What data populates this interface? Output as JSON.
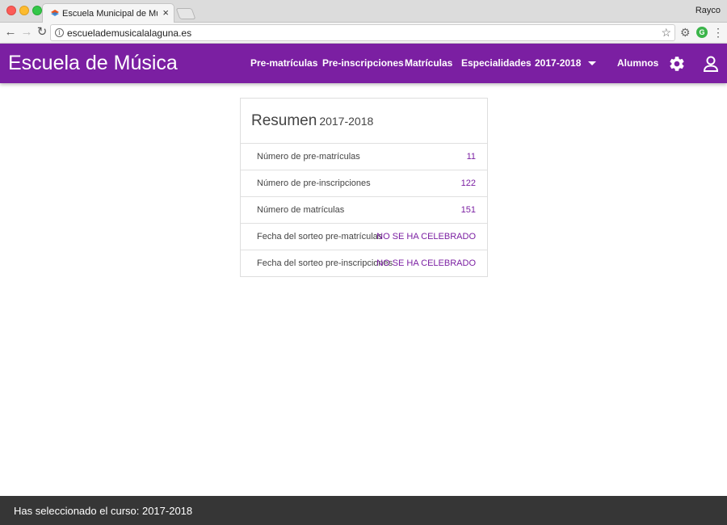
{
  "browser": {
    "tab_title": "Escuela Municipal de Música",
    "tab_close": "×",
    "profile_name": "Rayco",
    "url": "escuelademusicalalaguna.es",
    "icons": [
      "back-icon",
      "forward-icon",
      "reload-icon",
      "info-icon",
      "star-icon",
      "extension-gear-icon",
      "grammarly-icon",
      "menu-dots-icon"
    ]
  },
  "appbar": {
    "title": "Escuela de Música",
    "nav": {
      "premat": "Pre-matrículas",
      "preins": "Pre-inscripciones",
      "mat": "Matrículas",
      "esp": "Especialidades",
      "year": "2017-2018",
      "alumnos": "Alumnos"
    },
    "icons": [
      "settings-icon",
      "account-icon",
      "caret-down-icon"
    ],
    "color": "#7b1fa2"
  },
  "summary": {
    "title": "Resumen",
    "year": "2017-2018",
    "rows": [
      {
        "label": "Número de pre-matrículas",
        "value": "11"
      },
      {
        "label": "Número de pre-inscripciones",
        "value": "122"
      },
      {
        "label": "Número de matrículas",
        "value": "151"
      },
      {
        "label": "Fecha del sorteo pre-matrículas",
        "value": "NO SE HA CELEBRADO"
      },
      {
        "label": "Fecha del sorteo pre-inscripciones",
        "value": "NO SE HA CELEBRADO"
      }
    ],
    "accent_color": "#7b1fa2"
  },
  "footer": {
    "text": "Has seleccionado el curso: 2017-2018"
  }
}
